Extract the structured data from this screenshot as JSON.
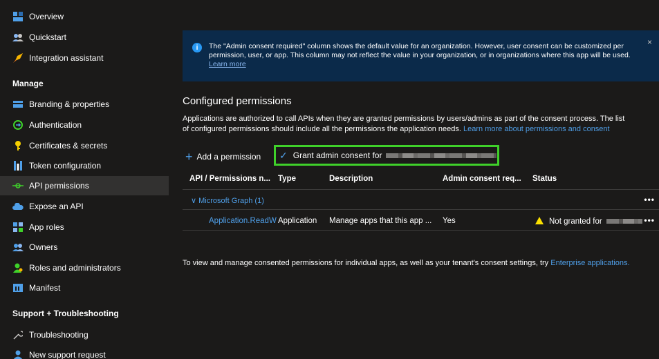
{
  "sidebar": {
    "items": [
      {
        "label": "Overview",
        "icon": "overview-icon"
      },
      {
        "label": "Quickstart",
        "icon": "quickstart-icon"
      },
      {
        "label": "Integration assistant",
        "icon": "rocket-icon"
      }
    ],
    "manage_header": "Manage",
    "manage_items": [
      {
        "label": "Branding & properties",
        "icon": "branding-icon"
      },
      {
        "label": "Authentication",
        "icon": "authentication-icon"
      },
      {
        "label": "Certificates & secrets",
        "icon": "key-icon"
      },
      {
        "label": "Token configuration",
        "icon": "token-icon"
      },
      {
        "label": "API permissions",
        "icon": "api-permissions-icon",
        "active": true
      },
      {
        "label": "Expose an API",
        "icon": "cloud-icon"
      },
      {
        "label": "App roles",
        "icon": "app-roles-icon"
      },
      {
        "label": "Owners",
        "icon": "owners-icon"
      },
      {
        "label": "Roles and administrators",
        "icon": "roles-icon"
      },
      {
        "label": "Manifest",
        "icon": "manifest-icon"
      }
    ],
    "support_header": "Support + Troubleshooting",
    "support_items": [
      {
        "label": "Troubleshooting",
        "icon": "wrench-icon"
      },
      {
        "label": "New support request",
        "icon": "support-person-icon"
      }
    ]
  },
  "banner": {
    "text": "The \"Admin consent required\" column shows the default value for an organization. However, user consent can be customized per permission, user, or app. This column may not reflect the value in your organization, or in organizations where this app will be used.",
    "link": "Learn more",
    "close": "×"
  },
  "configured": {
    "title": "Configured permissions",
    "desc_line1": "Applications are authorized to call APIs when they are granted permissions by users/admins as part of the consent process. The list",
    "desc_line2": "of configured permissions should include all the permissions the application needs.",
    "desc_link": "Learn more about permissions and consent"
  },
  "toolbar": {
    "add_label": "Add a permission",
    "grant_label": "Grant admin consent for"
  },
  "table": {
    "headers": [
      "API / Permissions n...",
      "Type",
      "Description",
      "Admin consent req...",
      "Status"
    ],
    "group": "Microsoft Graph (1)",
    "rows": [
      {
        "name": "Application.ReadW",
        "type": "Application",
        "description": "Manage apps that this app ...",
        "admin_consent": "Yes",
        "status": "Not granted for"
      }
    ],
    "more": "•••"
  },
  "footer": {
    "text": "To view and manage consented permissions for individual apps, as well as your tenant's consent settings, try",
    "link": "Enterprise applications."
  },
  "colors": {
    "accent": "#4f9fe8",
    "highlight": "#3fd12a",
    "warning": "#fce100",
    "banner_bg": "#0b2a4a"
  }
}
